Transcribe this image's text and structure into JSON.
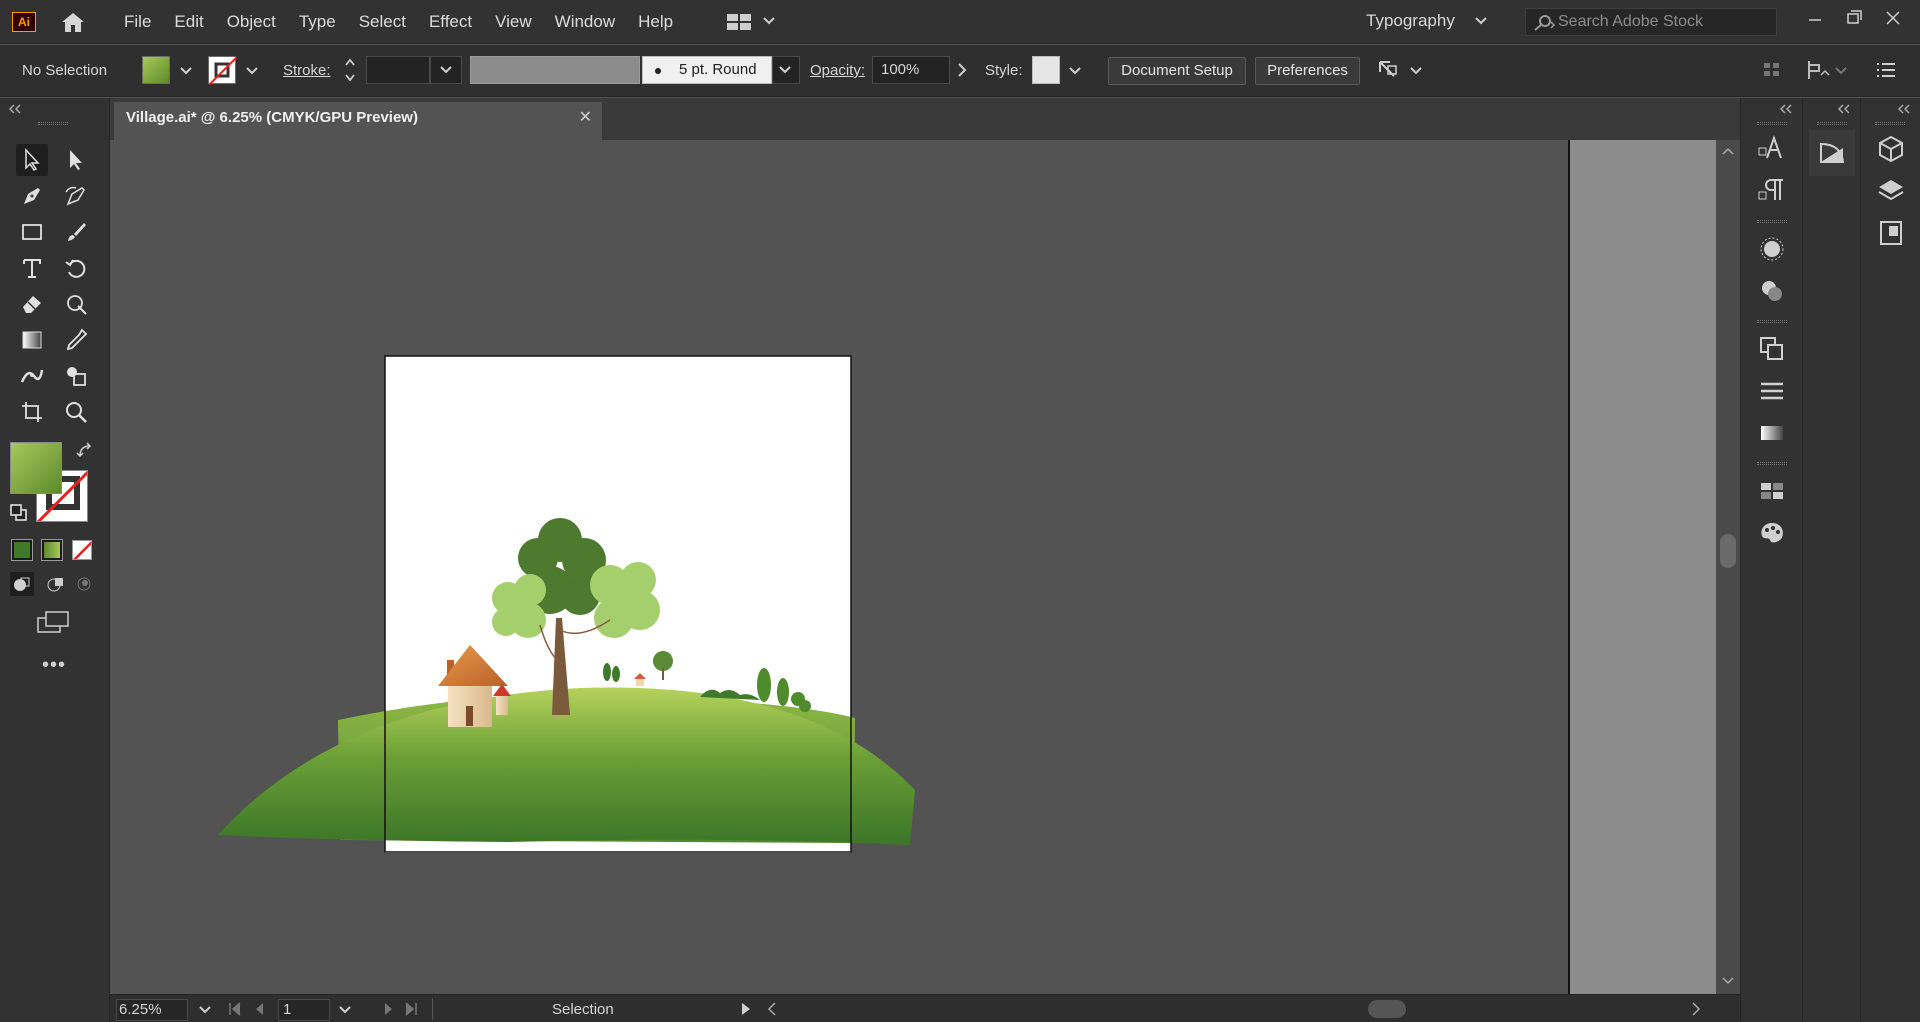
{
  "app": {
    "logo_text": "Ai",
    "workspace": "Typography",
    "search_placeholder": "Search Adobe Stock"
  },
  "menu": [
    "File",
    "Edit",
    "Object",
    "Type",
    "Select",
    "Effect",
    "View",
    "Window",
    "Help"
  ],
  "controlbar": {
    "selection_status": "No Selection",
    "stroke_label": "Stroke:",
    "brush_label": "5 pt. Round",
    "opacity_label": "Opacity:",
    "opacity_value": "100%",
    "style_label": "Style:",
    "document_setup": "Document Setup",
    "preferences": "Preferences"
  },
  "document_tab": {
    "title": "Village.ai* @ 6.25% (CMYK/GPU Preview)",
    "close": "✕"
  },
  "statusbar": {
    "zoom": "6.25%",
    "artboard_number": "1",
    "tool_name": "Selection"
  },
  "colors": {
    "fill_start": "#a8c85a",
    "fill_end": "#5c8a2c",
    "accent": "#ff9a00",
    "stroke_none": "#e2231a"
  },
  "tools": [
    "selection-tool",
    "direct-selection-tool",
    "pen-tool",
    "curvature-tool",
    "rectangle-tool",
    "paintbrush-tool",
    "type-tool",
    "rotate-tool",
    "eraser-tool",
    "puppet-warp-tool",
    "gradient-tool",
    "eyedropper-tool",
    "width-tool",
    "shape-builder-tool",
    "artboard-tool",
    "zoom-tool"
  ]
}
